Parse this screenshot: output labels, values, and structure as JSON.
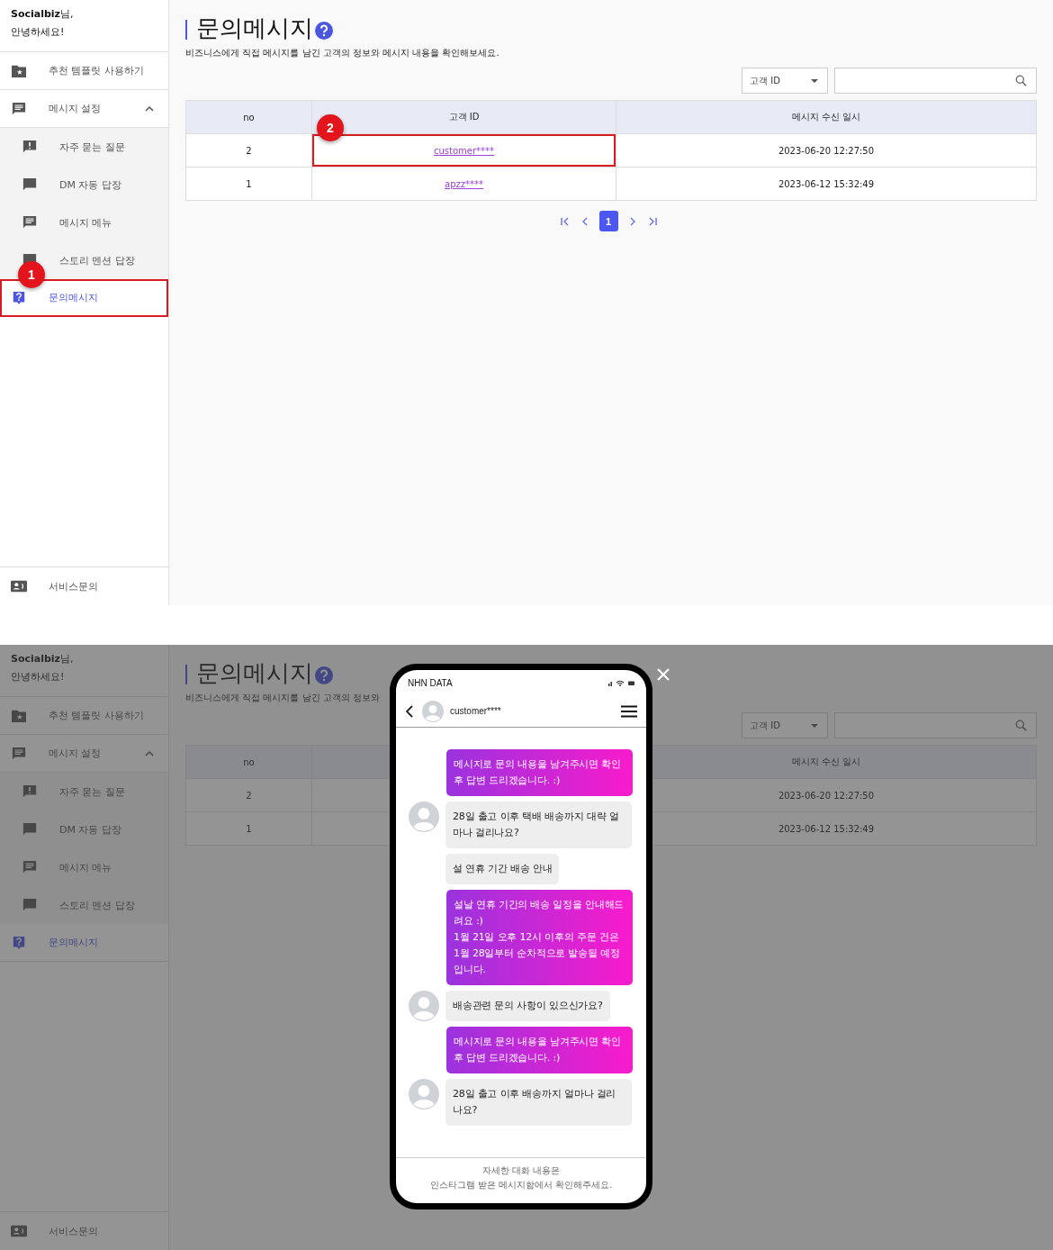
{
  "screens": [
    {
      "sidebar": {
        "greeting": [
          "**Socialbiz**님,",
          "안녕하세요!"
        ],
        "items": [
          {
            "label": "추천 템플릿 사용하기",
            "selected": false
          },
          {
            "label": "메시지 설정",
            "selected": false,
            "expanded": true,
            "children": [
              {
                "label": "자주 묻는 질문",
                "selected": false
              },
              {
                "label": "DM 자동 답장",
                "selected": false
              },
              {
                "label": "메시지 메뉴",
                "selected": false
              },
              {
                "label": "스토리 멘션 답장",
                "selected": false
              }
            ]
          },
          {
            "label": "문의메시지",
            "selected": true,
            "callout": "1"
          }
        ],
        "footer_item": {
          "label": "서비스문의"
        }
      },
      "page": {
        "title": "문의메시지",
        "description": "비즈니스에게 직접 메시지를 남긴 고객의 정보와 메시지 내용을 확인해보세요.",
        "filter": {
          "select": "고객 ID"
        },
        "table": {
          "columns": [
            {
              "label": "no",
              "kind": "text"
            },
            {
              "label": "고객 ID",
              "kind": "link"
            },
            {
              "label": "메시지 수신 일시",
              "kind": "text"
            }
          ],
          "rows": [
            {
              "cells": [
                "2",
                "customer****",
                "2023-06-20 12:27:50"
              ],
              "callout": "2"
            },
            {
              "cells": [
                "1",
                "apzz****",
                "2023-06-12 15:32:49"
              ]
            }
          ]
        },
        "pagination": {
          "pages": [
            {
              "label": "1",
              "selected": true
            }
          ]
        }
      }
    },
    {
      "sidebar": {
        "greeting": [
          "**Socialbiz**님,",
          "안녕하세요!"
        ],
        "items": [
          {
            "label": "추천 템플릿 사용하기",
            "selected": false
          },
          {
            "label": "메시지 설정",
            "selected": false,
            "expanded": true,
            "children": [
              {
                "label": "자주 묻는 질문",
                "selected": false
              },
              {
                "label": "DM 자동 답장",
                "selected": false
              },
              {
                "label": "메시지 메뉴",
                "selected": false
              },
              {
                "label": "스토리 멘션 답장",
                "selected": false
              }
            ]
          },
          {
            "label": "문의메시지",
            "selected": true
          }
        ],
        "footer_item": {
          "label": "서비스문의"
        }
      },
      "page": {
        "title": "문의메시지",
        "description": "비즈니스에게 직접 메시지를 남긴 고객의 정보와",
        "filter": {
          "select": "고객 ID"
        },
        "table": {
          "columns": [
            {
              "label": "no",
              "kind": "text"
            },
            null,
            {
              "label": "메시지 수신 일시",
              "kind": "text"
            }
          ],
          "rows": [
            {
              "cells": [
                "2",
                null,
                "2023-06-20 12:27:50"
              ]
            },
            {
              "cells": [
                "1",
                null,
                "2023-06-12 15:32:49"
              ]
            }
          ]
        }
      },
      "phone": {
        "carrier": "NHN DATA",
        "contact": "customer****",
        "messages": [
          {
            "kind": "outgoing",
            "text": "메시지로 문의 내용을 남겨주시면 확인 후 답변 드리겠습니다. :)"
          },
          {
            "kind": "incoming",
            "avatar": true,
            "text": "28일 출고 이후 택배 배송까지 대략 얼마나 걸리나요?"
          },
          {
            "kind": "incoming",
            "avatar": false,
            "text": "설 연휴 기간 배송 안내"
          },
          {
            "kind": "outgoing",
            "text": "설날 연휴 기간의 배송 일정을 안내해드려요 :)\n1월 21일 오후 12시 이후의 주문 건은 1월 28일부터 순차적으로 발송될 예정입니다."
          },
          {
            "kind": "incoming",
            "avatar": true,
            "text": "배송관련 문의 사항이 있으신가요?"
          },
          {
            "kind": "outgoing",
            "text": "메시지로 문의 내용을 남겨주시면 확인 후 답변 드리겠습니다. :)"
          },
          {
            "kind": "incoming",
            "avatar": true,
            "text": "28일 출고 이후 배송까지 얼마나 걸리나요?"
          }
        ],
        "footer": [
          "자세한 대화 내용은",
          "인스타그램 받은 메시지함에서 확인해주세요."
        ]
      }
    }
  ]
}
